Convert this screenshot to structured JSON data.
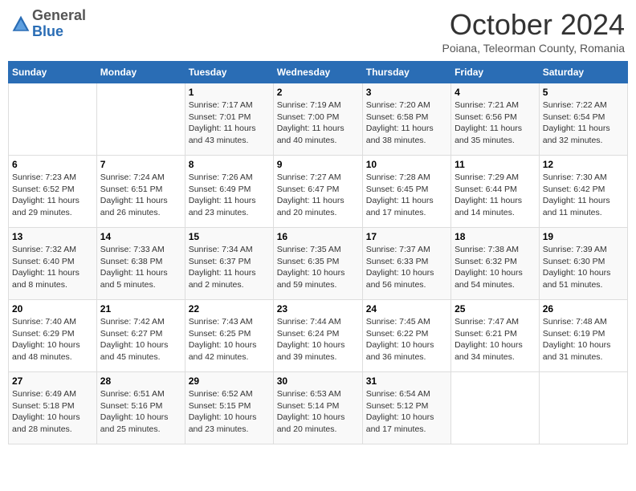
{
  "header": {
    "logo_line1": "General",
    "logo_line2": "Blue",
    "month": "October 2024",
    "location": "Poiana, Teleorman County, Romania"
  },
  "weekdays": [
    "Sunday",
    "Monday",
    "Tuesday",
    "Wednesday",
    "Thursday",
    "Friday",
    "Saturday"
  ],
  "weeks": [
    [
      {
        "day": "",
        "info": ""
      },
      {
        "day": "",
        "info": ""
      },
      {
        "day": "1",
        "info": "Sunrise: 7:17 AM\nSunset: 7:01 PM\nDaylight: 11 hours and 43 minutes."
      },
      {
        "day": "2",
        "info": "Sunrise: 7:19 AM\nSunset: 7:00 PM\nDaylight: 11 hours and 40 minutes."
      },
      {
        "day": "3",
        "info": "Sunrise: 7:20 AM\nSunset: 6:58 PM\nDaylight: 11 hours and 38 minutes."
      },
      {
        "day": "4",
        "info": "Sunrise: 7:21 AM\nSunset: 6:56 PM\nDaylight: 11 hours and 35 minutes."
      },
      {
        "day": "5",
        "info": "Sunrise: 7:22 AM\nSunset: 6:54 PM\nDaylight: 11 hours and 32 minutes."
      }
    ],
    [
      {
        "day": "6",
        "info": "Sunrise: 7:23 AM\nSunset: 6:52 PM\nDaylight: 11 hours and 29 minutes."
      },
      {
        "day": "7",
        "info": "Sunrise: 7:24 AM\nSunset: 6:51 PM\nDaylight: 11 hours and 26 minutes."
      },
      {
        "day": "8",
        "info": "Sunrise: 7:26 AM\nSunset: 6:49 PM\nDaylight: 11 hours and 23 minutes."
      },
      {
        "day": "9",
        "info": "Sunrise: 7:27 AM\nSunset: 6:47 PM\nDaylight: 11 hours and 20 minutes."
      },
      {
        "day": "10",
        "info": "Sunrise: 7:28 AM\nSunset: 6:45 PM\nDaylight: 11 hours and 17 minutes."
      },
      {
        "day": "11",
        "info": "Sunrise: 7:29 AM\nSunset: 6:44 PM\nDaylight: 11 hours and 14 minutes."
      },
      {
        "day": "12",
        "info": "Sunrise: 7:30 AM\nSunset: 6:42 PM\nDaylight: 11 hours and 11 minutes."
      }
    ],
    [
      {
        "day": "13",
        "info": "Sunrise: 7:32 AM\nSunset: 6:40 PM\nDaylight: 11 hours and 8 minutes."
      },
      {
        "day": "14",
        "info": "Sunrise: 7:33 AM\nSunset: 6:38 PM\nDaylight: 11 hours and 5 minutes."
      },
      {
        "day": "15",
        "info": "Sunrise: 7:34 AM\nSunset: 6:37 PM\nDaylight: 11 hours and 2 minutes."
      },
      {
        "day": "16",
        "info": "Sunrise: 7:35 AM\nSunset: 6:35 PM\nDaylight: 10 hours and 59 minutes."
      },
      {
        "day": "17",
        "info": "Sunrise: 7:37 AM\nSunset: 6:33 PM\nDaylight: 10 hours and 56 minutes."
      },
      {
        "day": "18",
        "info": "Sunrise: 7:38 AM\nSunset: 6:32 PM\nDaylight: 10 hours and 54 minutes."
      },
      {
        "day": "19",
        "info": "Sunrise: 7:39 AM\nSunset: 6:30 PM\nDaylight: 10 hours and 51 minutes."
      }
    ],
    [
      {
        "day": "20",
        "info": "Sunrise: 7:40 AM\nSunset: 6:29 PM\nDaylight: 10 hours and 48 minutes."
      },
      {
        "day": "21",
        "info": "Sunrise: 7:42 AM\nSunset: 6:27 PM\nDaylight: 10 hours and 45 minutes."
      },
      {
        "day": "22",
        "info": "Sunrise: 7:43 AM\nSunset: 6:25 PM\nDaylight: 10 hours and 42 minutes."
      },
      {
        "day": "23",
        "info": "Sunrise: 7:44 AM\nSunset: 6:24 PM\nDaylight: 10 hours and 39 minutes."
      },
      {
        "day": "24",
        "info": "Sunrise: 7:45 AM\nSunset: 6:22 PM\nDaylight: 10 hours and 36 minutes."
      },
      {
        "day": "25",
        "info": "Sunrise: 7:47 AM\nSunset: 6:21 PM\nDaylight: 10 hours and 34 minutes."
      },
      {
        "day": "26",
        "info": "Sunrise: 7:48 AM\nSunset: 6:19 PM\nDaylight: 10 hours and 31 minutes."
      }
    ],
    [
      {
        "day": "27",
        "info": "Sunrise: 6:49 AM\nSunset: 5:18 PM\nDaylight: 10 hours and 28 minutes."
      },
      {
        "day": "28",
        "info": "Sunrise: 6:51 AM\nSunset: 5:16 PM\nDaylight: 10 hours and 25 minutes."
      },
      {
        "day": "29",
        "info": "Sunrise: 6:52 AM\nSunset: 5:15 PM\nDaylight: 10 hours and 23 minutes."
      },
      {
        "day": "30",
        "info": "Sunrise: 6:53 AM\nSunset: 5:14 PM\nDaylight: 10 hours and 20 minutes."
      },
      {
        "day": "31",
        "info": "Sunrise: 6:54 AM\nSunset: 5:12 PM\nDaylight: 10 hours and 17 minutes."
      },
      {
        "day": "",
        "info": ""
      },
      {
        "day": "",
        "info": ""
      }
    ]
  ]
}
